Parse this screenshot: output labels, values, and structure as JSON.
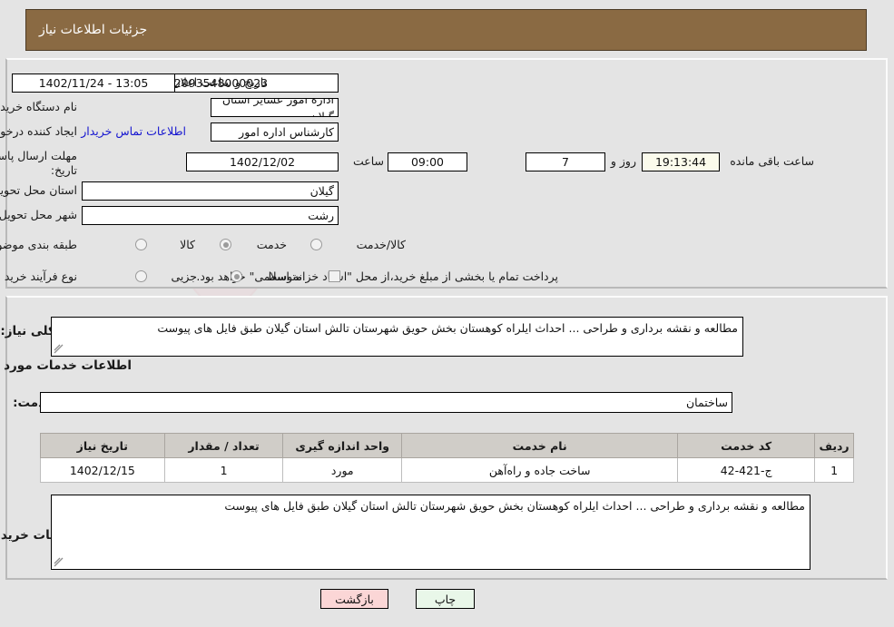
{
  "header": {
    "title": "جزئیات اطلاعات نیاز"
  },
  "fields": {
    "need_number_label": "شماره نیاز:",
    "need_number_value": "1102093548000023",
    "announce_label": "تاریخ و ساعت اعلان عمومی:",
    "announce_value": "13:05 - 1402/11/24",
    "buyer_org_label": "نام دستگاه خریدار:",
    "buyer_org_value": "اداره امور عشایر استان گیلان",
    "creator_label": "ایجاد کننده درخواست:",
    "creator_value": "امین نیکخوی مجره کارشناس اداره امور عشایر استان گیلان",
    "contact_link": "اطلاعات تماس خریدار",
    "deadline_label_line1": "مهلت ارسال پاسخ: تا",
    "deadline_label_line2": "تاریخ:",
    "deadline_date": "1402/12/02",
    "deadline_hour_label": "ساعت",
    "deadline_hour": "09:00",
    "remaining_days": "7",
    "days_and_label": "روز و",
    "remaining_time": "19:13:44",
    "remaining_suffix": "ساعت باقی مانده",
    "province_label": "استان محل تحویل:",
    "province_value": "گیلان",
    "city_label": "شهر محل تحویل:",
    "city_value": "رشت",
    "category_label": "طبقه بندی موضوعی:",
    "process_label": "نوع فرآیند خرید :",
    "treasury_note": "پرداخت تمام یا بخشی از مبلغ خرید،از محل \"اسناد خزانه اسلامی\" خواهد بود."
  },
  "category_options": [
    {
      "label": "کالا",
      "selected": false
    },
    {
      "label": "خدمت",
      "selected": true
    },
    {
      "label": "کالا/خدمت",
      "selected": false
    }
  ],
  "process_options": [
    {
      "label": "جزیی",
      "selected": false
    },
    {
      "label": "متوسط",
      "selected": true
    }
  ],
  "summary": {
    "label": "شرح کلی نیاز:",
    "value": "مطالعه و نقشه برداری و طراحی ... احداث ایلراه کوهستان بخش حویق شهرستان تالش استان گیلان طبق فایل های پیوست"
  },
  "services_section": {
    "heading": "اطلاعات خدمات مورد نیاز",
    "group_label": "گروه خدمت:",
    "group_value": "ساختمان"
  },
  "table": {
    "headers": [
      "ردیف",
      "کد خدمت",
      "نام خدمت",
      "واحد اندازه گیری",
      "تعداد / مقدار",
      "تاریخ نیاز"
    ],
    "rows": [
      {
        "row": "1",
        "service_code": "ج-421-42",
        "service_name": "ساخت جاده و راه‌آهن",
        "unit": "مورد",
        "quantity": "1",
        "need_date": "1402/12/15"
      }
    ]
  },
  "buyer_notes": {
    "label": "توضیحات خریدار:",
    "value": "مطالعه و نقشه برداری و طراحی ... احداث ایلراه کوهستان بخش حویق شهرستان تالش استان گیلان طبق فایل های پیوست"
  },
  "buttons": {
    "print": "چاپ",
    "back": "بازگشت"
  },
  "watermark": {
    "text": "AriaTender.net"
  },
  "colors": {
    "header_bar": "#8a6a43",
    "page_bg": "#e4e4e4",
    "link": "#1515d0",
    "print_btn": "#e9f7e9",
    "back_btn": "#fbd6d6",
    "countdown_bg": "#fbfbec",
    "table_header": "#d0cdc8"
  }
}
